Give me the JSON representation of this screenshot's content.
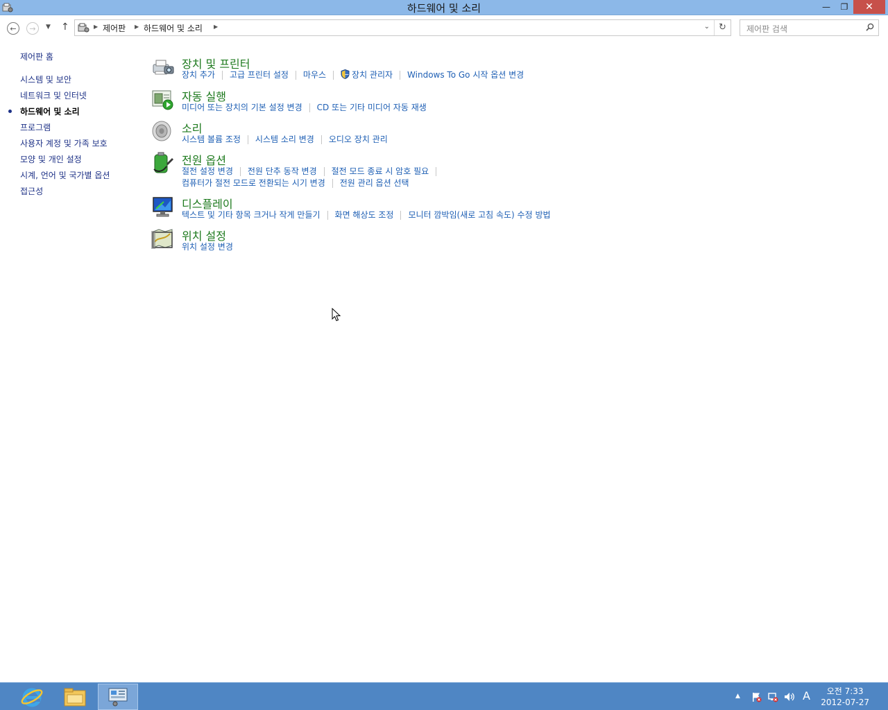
{
  "window": {
    "title": "하드웨어 및 소리",
    "minimize_glyph": "—",
    "maximize_glyph": "❐",
    "close_glyph": "✕"
  },
  "nav": {
    "back_icon": "back-arrow-icon",
    "forward_icon": "forward-arrow-icon",
    "recent_icon": "chevron-down-icon",
    "up_icon": "up-arrow-icon",
    "breadcrumbs": [
      "제어판",
      "하드웨어 및 소리"
    ],
    "search_placeholder": "제어판 검색"
  },
  "sidebar": {
    "home": "제어판 홈",
    "items": [
      {
        "label": "시스템 및 보안",
        "current": false
      },
      {
        "label": "네트워크 및 인터넷",
        "current": false
      },
      {
        "label": "하드웨어 및 소리",
        "current": true
      },
      {
        "label": "프로그램",
        "current": false
      },
      {
        "label": "사용자 계정 및 가족 보호",
        "current": false
      },
      {
        "label": "모양 및 개인 설정",
        "current": false
      },
      {
        "label": "시계, 언어 및 국가별 옵션",
        "current": false
      },
      {
        "label": "접근성",
        "current": false
      }
    ]
  },
  "categories": [
    {
      "title": "장치 및 프린터",
      "icon": "printer-camera-icon",
      "links": [
        "장치 추가",
        "고급 프린터 설정",
        "마우스",
        "장치 관리자",
        "Windows To Go 시작 옵션 변경"
      ]
    },
    {
      "title": "자동 실행",
      "icon": "autoplay-icon",
      "links": [
        "미디어 또는 장치의 기본 설정 변경",
        "CD 또는 기타 미디어 자동 재생"
      ]
    },
    {
      "title": "소리",
      "icon": "speaker-icon",
      "links": [
        "시스템 볼륨 조정",
        "시스템 소리 변경",
        "오디오 장치 관리"
      ]
    },
    {
      "title": "전원 옵션",
      "icon": "battery-plug-icon",
      "links": [
        "절전 설정 변경",
        "전원 단추 동작 변경",
        "절전 모드 종료 시 암호 필요"
      ],
      "links_row2": [
        "컴퓨터가 절전 모드로 전환되는 시기 변경",
        "전원 관리 옵션 선택"
      ]
    },
    {
      "title": "디스플레이",
      "icon": "monitor-icon",
      "links": [
        "텍스트 및 기타 항목 크거나 작게 만들기",
        "화면 해상도 조정",
        "모니터 깜박임(새로 고침 속도) 수정 방법"
      ]
    },
    {
      "title": "위치 설정",
      "icon": "location-map-icon",
      "links": [
        "위치 설정 변경"
      ]
    }
  ],
  "taskbar": {
    "apps": [
      "internet-explorer-icon",
      "file-explorer-icon",
      "control-panel-icon"
    ],
    "tray_ime": "A",
    "clock_time": "오전 7:33",
    "clock_date": "2012-07-27"
  },
  "colors": {
    "titlebar": "#8cb8e8",
    "taskbar": "#4f86c4",
    "category_heading": "#1e7a1e",
    "link": "#1e5fb4",
    "sidebar_link": "#1e3287"
  }
}
